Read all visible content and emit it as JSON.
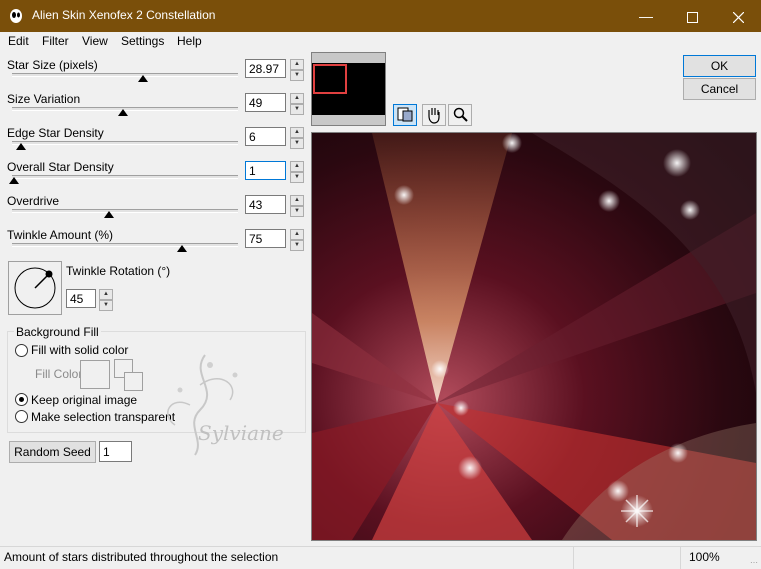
{
  "window": {
    "title": "Alien Skin Xenofex 2 Constellation"
  },
  "menu": [
    "Edit",
    "Filter",
    "View",
    "Settings",
    "Help"
  ],
  "params": [
    {
      "label": "Star Size (pixels)",
      "value": "28.97",
      "level": 0.58
    },
    {
      "label": "Size Variation",
      "value": "49",
      "level": 0.49
    },
    {
      "label": "Edge Star Density",
      "value": "6",
      "level": 0.04
    },
    {
      "label": "Overall Star Density",
      "value": "1",
      "level": 0.01
    },
    {
      "label": "Overdrive",
      "value": "43",
      "level": 0.43
    },
    {
      "label": "Twinkle Amount (%)",
      "value": "75",
      "level": 0.75
    }
  ],
  "twinkle_rotation": {
    "label": "Twinkle Rotation (°)",
    "value": "45"
  },
  "background_fill": {
    "title": "Background Fill",
    "option_solid": "Fill with solid color",
    "fill_color_label": "Fill Color",
    "option_keep": "Keep original image",
    "option_transparent": "Make selection transparent"
  },
  "random_seed": {
    "label": "Random Seed",
    "value": "1"
  },
  "buttons": {
    "ok": "OK",
    "cancel": "Cancel"
  },
  "watermark": "Sylviane",
  "status": {
    "text": "Amount of stars distributed throughout the selection",
    "zoom": "100%"
  },
  "icons": {
    "app": "alien-head-icon",
    "preview_tool": "preview-compare-icon",
    "hand": "hand-pan-icon",
    "zoom": "magnifier-icon"
  }
}
